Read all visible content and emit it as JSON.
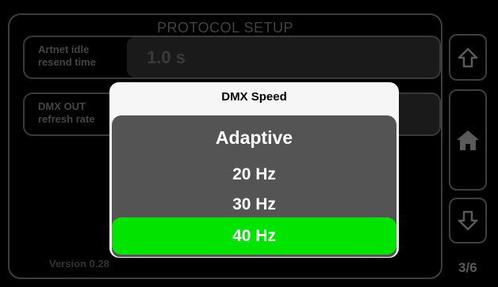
{
  "screen": {
    "title": "PROTOCOL SETUP",
    "settings": [
      {
        "label_line1": "Artnet idle",
        "label_line2": "resend time",
        "value": "1.0 s"
      },
      {
        "label_line1": "DMX OUT",
        "label_line2": "refresh rate",
        "value": ""
      }
    ],
    "version": "Version 0.28",
    "page": "3/6",
    "nav_icons": [
      "arrow-up-icon",
      "home-icon",
      "arrow-down-icon"
    ]
  },
  "modal": {
    "title": "DMX Speed",
    "options": [
      "Adaptive",
      "20 Hz",
      "30 Hz",
      "40 Hz"
    ],
    "selected": "40 Hz"
  },
  "colors": {
    "selected_bg": "#00e400",
    "list_bg": "#545454",
    "dialog_bg": "#f6f6f6",
    "dim_text": "#454545"
  }
}
